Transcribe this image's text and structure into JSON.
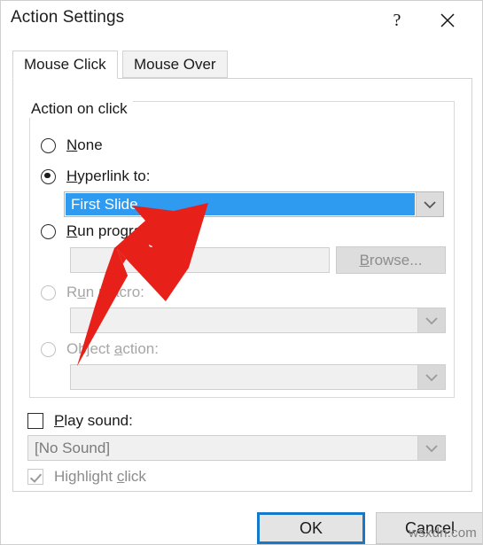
{
  "window": {
    "title": "Action Settings",
    "help_icon": "question-mark-icon",
    "close_icon": "close-icon"
  },
  "tabs": [
    {
      "label": "Mouse Click",
      "active": true
    },
    {
      "label": "Mouse Over",
      "active": false
    }
  ],
  "group": {
    "legend": "Action on click",
    "options": [
      {
        "key": "none",
        "label": "None",
        "accel": "N",
        "selected": false,
        "disabled": false
      },
      {
        "key": "hyperlink",
        "label": "Hyperlink to:",
        "accel": "H",
        "selected": true,
        "disabled": false
      },
      {
        "key": "run_program",
        "label": "Run program:",
        "accel": "R",
        "selected": false,
        "disabled": false
      },
      {
        "key": "run_macro",
        "label": "Run macro:",
        "accel": "M",
        "selected": false,
        "disabled": true
      },
      {
        "key": "object_action",
        "label": "Object action:",
        "accel": "a",
        "selected": false,
        "disabled": true
      }
    ],
    "hyperlink_combo": {
      "value": "First Slide",
      "highlighted": true
    },
    "run_program_textbox": {
      "value": "",
      "placeholder": ""
    },
    "browse_button": {
      "label": "Browse...",
      "accel": "B",
      "disabled": true
    },
    "run_macro_combo": {
      "value": "",
      "disabled": true
    },
    "object_action_combo": {
      "value": "",
      "disabled": true
    }
  },
  "footer_options": {
    "play_sound": {
      "label": "Play sound:",
      "accel": "P",
      "checked": false,
      "disabled": false
    },
    "sound_combo": {
      "value": "[No Sound]",
      "disabled": true
    },
    "highlight_click": {
      "label": "Highlight click",
      "accel": "c",
      "checked": true,
      "disabled": true
    }
  },
  "buttons": {
    "ok": "OK",
    "cancel": "Cancel"
  },
  "annotation": {
    "arrow_color": "#e8201a",
    "from": [
      232,
      229
    ],
    "to": [
      86,
      412
    ]
  },
  "watermark": "wsxdn.com",
  "colors": {
    "selection_blue": "#2e9bf0",
    "focus_blue": "#1878c8",
    "dialog_bg": "#ffffff",
    "control_gray": "#f0f0f0"
  }
}
